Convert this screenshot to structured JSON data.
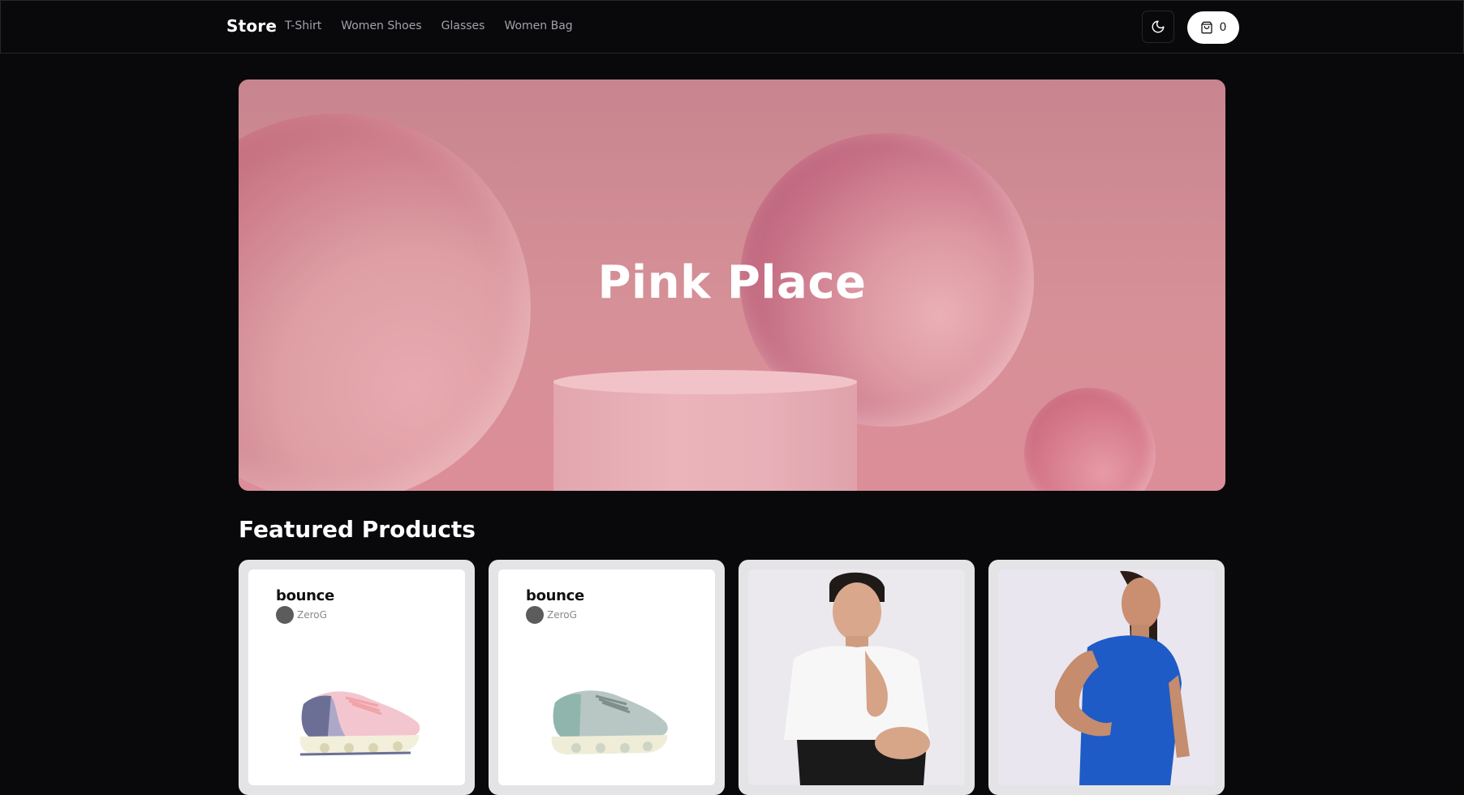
{
  "header": {
    "brand": "Store",
    "nav": [
      "T-Shirt",
      "Women Shoes",
      "Glasses",
      "Women Bag"
    ],
    "cart_count": "0",
    "theme_icon": "moon-icon",
    "cart_icon": "shopping-bag-icon"
  },
  "hero": {
    "title": "Pink Place"
  },
  "featured": {
    "title": "Featured Products",
    "products": [
      {
        "logo": "bounce",
        "logo_sub": "ZeroG"
      },
      {
        "logo": "bounce",
        "logo_sub": "ZeroG"
      },
      {},
      {}
    ]
  },
  "colors": {
    "background": "#09090b",
    "border": "#27272a",
    "nav_text": "#a1a1aa",
    "hero_pink": "#d69097",
    "card_bg": "#e4e4e7"
  }
}
